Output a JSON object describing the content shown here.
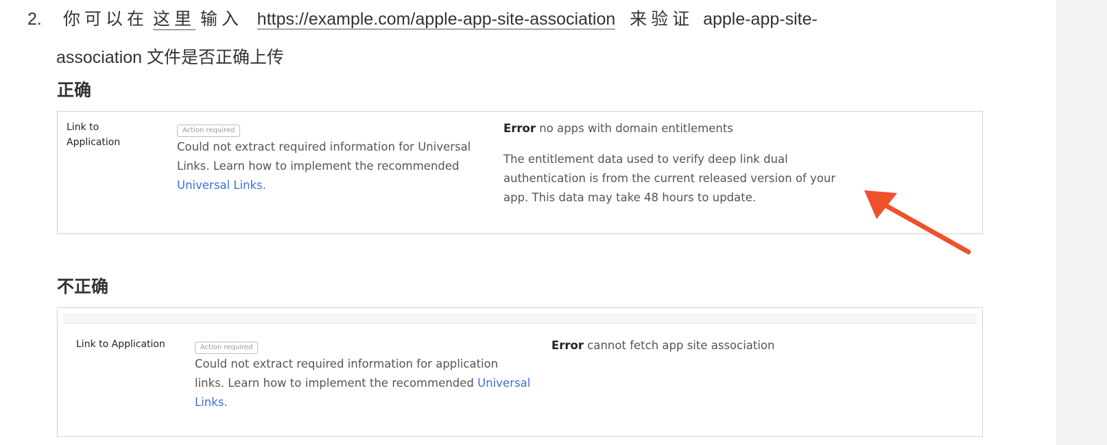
{
  "step": {
    "number": "2.",
    "text_before": "你可以在",
    "here_link": "这里",
    "text_input": "输入",
    "url": "https://example.com/apple-app-site-association",
    "text_verify": "来验证",
    "text_line1_tail": "apple-app-site-",
    "text_line2": "association 文件是否正确上传"
  },
  "correct": {
    "heading": "正确",
    "label": "Link to Application",
    "badge": "Action required",
    "desc_text": "Could not extract required information for Universal Links. Learn how to implement the recommended",
    "desc_link": "Universal Links.",
    "error_keyword": "Error",
    "error_text": "no apps with domain entitlements",
    "note": "The entitlement data used to verify deep link dual authentication is from the current released version of your app. This data may take 48 hours to update."
  },
  "incorrect": {
    "heading": "不正确",
    "label": "Link to Application",
    "badge": "Action required",
    "desc_text": "Could not extract required information for application links. Learn how to implement the recommended",
    "desc_link": "Universal Links.",
    "error_keyword": "Error",
    "error_text": "cannot fetch app site association"
  },
  "colors": {
    "arrow": "#f0502a",
    "link_blue": "#3b6fd4",
    "sidebar_bg": "#f3f3f3"
  }
}
